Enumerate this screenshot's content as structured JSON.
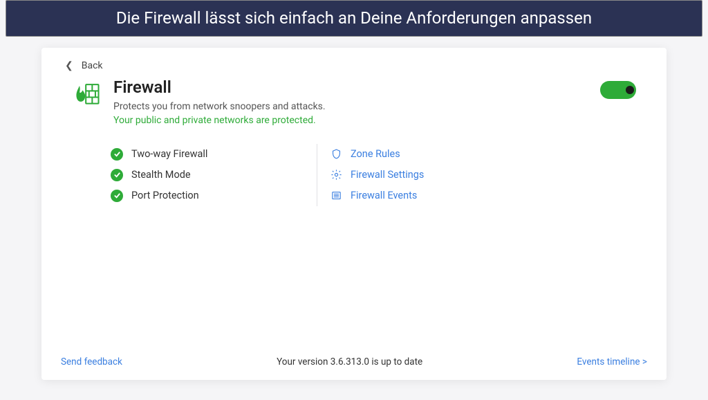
{
  "banner_text": "Die Firewall lässt sich einfach an Deine Anforderungen anpassen",
  "back_label": "Back",
  "title": "Firewall",
  "subtitle": "Protects you from network snoopers and attacks.",
  "status": "Your public and private networks are protected.",
  "toggle_on": true,
  "features": {
    "items": [
      {
        "label": "Two-way Firewall"
      },
      {
        "label": "Stealth Mode"
      },
      {
        "label": "Port Protection"
      }
    ]
  },
  "links": {
    "items": [
      {
        "label": "Zone Rules",
        "icon": "shield-icon"
      },
      {
        "label": "Firewall Settings",
        "icon": "gear-icon"
      },
      {
        "label": "Firewall Events",
        "icon": "list-icon"
      }
    ]
  },
  "footer": {
    "feedback": "Send feedback",
    "version": "Your version 3.6.313.0 is up to date",
    "timeline": "Events timeline >"
  }
}
